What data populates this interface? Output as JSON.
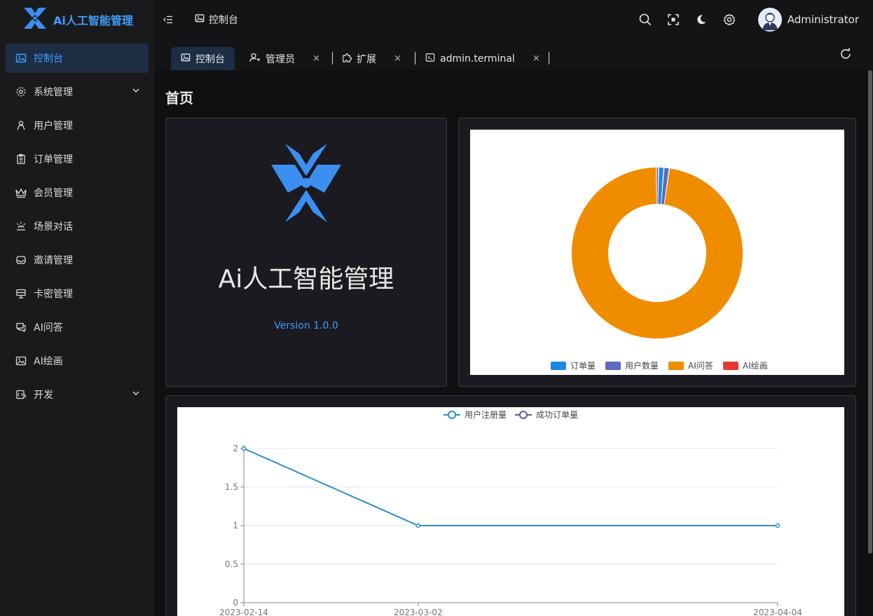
{
  "app": {
    "title": "Ai人工智能管理"
  },
  "sidebar": {
    "items": [
      {
        "label": "控制台",
        "icon": "image-icon",
        "active": true
      },
      {
        "label": "系统管理",
        "icon": "gear-icon",
        "expandable": true
      },
      {
        "label": "用户管理",
        "icon": "user-icon"
      },
      {
        "label": "订单管理",
        "icon": "clipboard-icon"
      },
      {
        "label": "会员管理",
        "icon": "crown-icon"
      },
      {
        "label": "场景对话",
        "icon": "scene-icon"
      },
      {
        "label": "邀请管理",
        "icon": "inbox-icon"
      },
      {
        "label": "卡密管理",
        "icon": "card-icon"
      },
      {
        "label": "AI问答",
        "icon": "chat-icon"
      },
      {
        "label": "AI绘画",
        "icon": "picture-icon"
      },
      {
        "label": "开发",
        "icon": "dev-icon",
        "expandable": true
      }
    ]
  },
  "header": {
    "breadcrumb": "控制台",
    "username": "Administrator"
  },
  "tabs": [
    {
      "label": "控制台",
      "active": true
    },
    {
      "label": "管理员",
      "close": "×"
    },
    {
      "label": "扩展",
      "close": "×"
    },
    {
      "label": "admin.terminal",
      "close": "×"
    }
  ],
  "main": {
    "page_title": "首页",
    "brand_title": "Ai人工智能管理",
    "version": "Version 1.0.0"
  },
  "colors": {
    "accent": "#409eff",
    "orders": "#1e88e5",
    "users": "#5c6bc0",
    "ai_qa": "#f08c00",
    "ai_draw": "#e53935",
    "line_users": "#2b8cc4",
    "line_orders": "#5a5a9a"
  },
  "chart_data": [
    {
      "type": "pie",
      "variant": "donut",
      "labels": [
        "订单量",
        "用户数量",
        "AI问答",
        "AI绘画"
      ],
      "values": [
        1,
        1,
        96,
        0.4
      ],
      "legend": "bottom"
    },
    {
      "type": "line",
      "x": [
        "2023-02-14",
        "2023-03-02",
        "2023-04-04"
      ],
      "series": [
        {
          "name": "用户注册量",
          "values": [
            2,
            1,
            1
          ]
        },
        {
          "name": "成功订单量",
          "values": []
        }
      ],
      "yticks": [
        "0",
        "0.5",
        "1",
        "1.5",
        "2"
      ],
      "ylim": [
        0,
        2
      ],
      "legend": "top",
      "grid": true
    }
  ]
}
